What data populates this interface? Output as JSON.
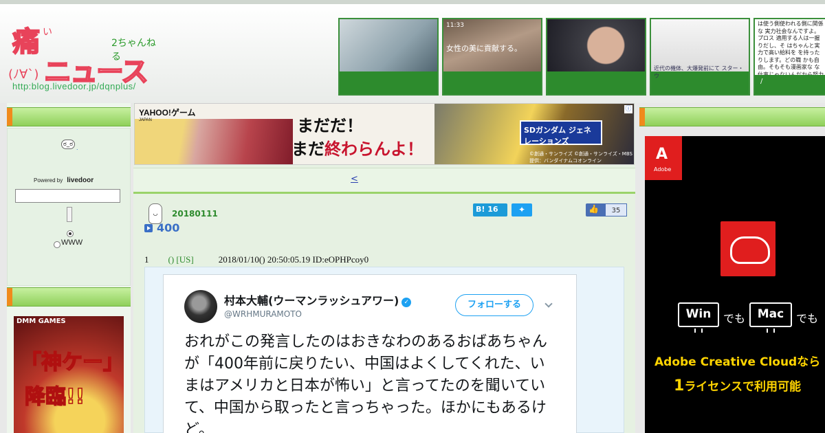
{
  "header": {
    "logo_main_top": "痛",
    "logo_main_bottom": "ニュース",
    "logo_small_i": "い",
    "logo_small_chan": "2ちゃんねる",
    "logo_face": "(ﾉ∀`)",
    "logo_url": "http:blog.livedoor.jp/dqnplus/",
    "thumbnails": [
      {
        "label": "",
        "caption": ""
      },
      {
        "label": "11:33",
        "caption": "女性の美に貢献する。"
      },
      {
        "label": "",
        "caption": ""
      },
      {
        "label": "",
        "caption": "近代の機体、大爆発前にて スター・ウ"
      },
      {
        "text": "は使う側使われる側に関係な 実力社会なんですよ。プロス 適用する人は一握りだし、そ はちゃんと実力で高い給料を を持ったりします。どの職 かも自由。そもそも漫画家な な仕事じゃないんだから努力 しない",
        "slash": "/"
      }
    ]
  },
  "left": {
    "hmm_icon": "ಠ_ಠ",
    "hmm_dot": ".",
    "powered_by": "Powered by",
    "livedoor": "livedoor",
    "search_value": "",
    "www_label": "WWW",
    "ad_brand": "DMM GAMES",
    "ad_line1": "「神ケー」",
    "ad_line2": "降臨!!"
  },
  "center": {
    "banner": {
      "yahoo": "YAHOO!",
      "yahoo_sub": "JAPAN",
      "yahoo_game": "ゲーム",
      "slogan1": "まだだ！",
      "slogan2_a": "まだ",
      "slogan2_b": "終わらんよ！",
      "game_logo": "SDガンダム ジェネレーションズ",
      "copyright": "©創通・サンライズ ©創通・サンライズ・MBS 提供：バンダイナムコオンライン",
      "ad_badge": "ⓘ"
    },
    "nav_link": "<  ",
    "article": {
      "mascot": "◡",
      "date": "20180111",
      "hatena_label": "B! 16",
      "tweet_label": "",
      "like_count": "35",
      "title": "400",
      "res_num": "1",
      "res_name": "() [US]",
      "res_meta": "2018/01/10() 20:50:05.19 ID:eOPHPcoy0"
    },
    "tweet": {
      "name": "村本大輔(ウーマンラッシュアワー)",
      "handle": "@WRHMURAMOTO",
      "follow": "フォローする",
      "verified": "✓",
      "text": "おれがこの発言したのはおきなわのあるおばあちゃんが「400年前に戻りたい、中国はよくしてくれた、いまはアメリカと日本が怖い」と言ってたのを聞いていて、中国から取ったと言っちゃった。ほかにもあるけど。"
    }
  },
  "right": {
    "adobe": "A",
    "adobe_word": "Adobe",
    "win": "Win",
    "mac": "Mac",
    "demo": "でも",
    "line1": "Adobe Creative Cloudなら",
    "line2_num": "1",
    "line2_rest": "ライセンスで利用可能"
  },
  "colors": {
    "green_bar": "#8fd05a",
    "accent_orange": "#f08a1c",
    "link_blue": "#2a3fb0",
    "twitter_blue": "#1da1f2",
    "adobe_red": "#e01e1e"
  }
}
